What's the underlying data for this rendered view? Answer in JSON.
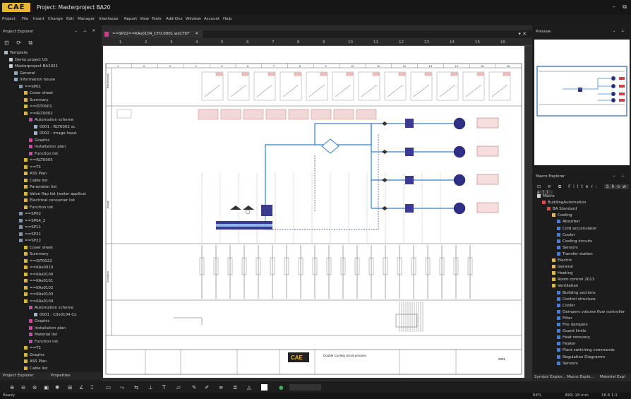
{
  "app": {
    "logo": "CAE",
    "title": "Project: Masterproject BA20"
  },
  "window_buttons": "– ⧉",
  "menu": [
    "Project",
    "File",
    "Insert",
    "Change",
    "Edit",
    "Manager",
    "Interfaces",
    "Report",
    "View",
    "Tools",
    "Add-Ons",
    "Window",
    "Account",
    "Help"
  ],
  "project_explorer": {
    "title": "Project Explorer",
    "tree": [
      {
        "label": "Template",
        "depth": 0
      },
      {
        "label": "Demo project US",
        "depth": 1
      },
      {
        "label": "Masterproject BA2021",
        "depth": 1
      },
      {
        "label": "General",
        "depth": 2
      },
      {
        "label": "Information house",
        "depth": 2
      },
      {
        "label": "==SP01",
        "depth": 3
      },
      {
        "label": "Cover sheet",
        "depth": 4
      },
      {
        "label": "Summary",
        "depth": 4
      },
      {
        "label": "==IST0001",
        "depth": 4
      },
      {
        "label": "==RLT0002",
        "depth": 4
      },
      {
        "label": "Automation scheme",
        "depth": 5
      },
      {
        "label": "0001 : RLT0002 sc",
        "depth": 6
      },
      {
        "label": "0002 : Image Input",
        "depth": 6
      },
      {
        "label": "Graphic",
        "depth": 5
      },
      {
        "label": "Installation plan",
        "depth": 5
      },
      {
        "label": "Function list",
        "depth": 5
      },
      {
        "label": "==RLT0005",
        "depth": 4
      },
      {
        "label": "==T1",
        "depth": 4
      },
      {
        "label": "ASS Plan",
        "depth": 4
      },
      {
        "label": "Cable list",
        "depth": 4
      },
      {
        "label": "Parameter list",
        "depth": 4
      },
      {
        "label": "Valve flap list (water applicat",
        "depth": 4
      },
      {
        "label": "Electrical consumer list",
        "depth": 4
      },
      {
        "label": "Function list",
        "depth": 4
      },
      {
        "label": "==SP02",
        "depth": 3
      },
      {
        "label": "==SP04_2",
        "depth": 3
      },
      {
        "label": "==SP11",
        "depth": 3
      },
      {
        "label": "==SP21",
        "depth": 3
      },
      {
        "label": "==SP22",
        "depth": 3
      },
      {
        "label": "Cover sheet",
        "depth": 4
      },
      {
        "label": "Summary",
        "depth": 4
      },
      {
        "label": "==IST0022",
        "depth": 4
      },
      {
        "label": "==KAs0010",
        "depth": 4
      },
      {
        "label": "==KAs0100",
        "depth": 4
      },
      {
        "label": "==KAs0101",
        "depth": 4
      },
      {
        "label": "==KAs0102",
        "depth": 4
      },
      {
        "label": "==KAs0103",
        "depth": 4
      },
      {
        "label": "==KAs0104",
        "depth": 4
      },
      {
        "label": "Automation scheme",
        "depth": 5
      },
      {
        "label": "0001 : C0s0104 Co",
        "depth": 6
      },
      {
        "label": "Graphic",
        "depth": 5
      },
      {
        "label": "Installation plan",
        "depth": 5
      },
      {
        "label": "Material list",
        "depth": 5
      },
      {
        "label": "Function list",
        "depth": 5
      },
      {
        "label": "==T1",
        "depth": 4
      },
      {
        "label": "Graphic",
        "depth": 4
      },
      {
        "label": "ASS Plan",
        "depth": 4
      },
      {
        "label": "Cable list",
        "depth": 4
      }
    ],
    "tabs": [
      "Project Explorer",
      "Properties"
    ]
  },
  "document": {
    "tab_label": "==SP22==KAs0104_CTD.0001.wsCTD*",
    "ruler": [
      "1",
      "2",
      "3",
      "4",
      "5",
      "6",
      "7",
      "8",
      "9",
      "10",
      "11",
      "12",
      "13",
      "14",
      "15",
      "16"
    ],
    "sheet_columns": [
      "1",
      "2",
      "3",
      "4",
      "5",
      "6",
      "7",
      "8",
      "9",
      "10",
      "11",
      "12",
      "13",
      "14",
      "15",
      "16"
    ],
    "row_labels": [
      "Betriebsmeld.",
      "Anlage",
      "Schaltschr."
    ],
    "title_block": {
      "company": "CAE",
      "description": "Double Cooling circuit process",
      "sheet": "0001"
    }
  },
  "preview": {
    "title": "Preview"
  },
  "macro_explorer": {
    "title": "Macro Explorer",
    "filter_label": "Filter:",
    "filter_value": "Show all",
    "tree": [
      {
        "label": "Macro",
        "depth": 0
      },
      {
        "label": "BuildingAutomation",
        "depth": 1
      },
      {
        "label": "BA Standard",
        "depth": 2
      },
      {
        "label": "Cooling",
        "depth": 3
      },
      {
        "label": "Absorber",
        "depth": 4
      },
      {
        "label": "Cold accumulator",
        "depth": 4
      },
      {
        "label": "Cooler",
        "depth": 4
      },
      {
        "label": "Cooling circuits",
        "depth": 4
      },
      {
        "label": "Sensors",
        "depth": 4
      },
      {
        "label": "Transfer station",
        "depth": 4
      },
      {
        "label": "Electric",
        "depth": 3
      },
      {
        "label": "General",
        "depth": 3
      },
      {
        "label": "Heating",
        "depth": 3
      },
      {
        "label": "Room control 2013",
        "depth": 3
      },
      {
        "label": "Ventilation",
        "depth": 3
      },
      {
        "label": "Building sections",
        "depth": 4
      },
      {
        "label": "Control structure",
        "depth": 4
      },
      {
        "label": "Cooler",
        "depth": 4
      },
      {
        "label": "Dampers volume flow controller",
        "depth": 4
      },
      {
        "label": "Filter",
        "depth": 4
      },
      {
        "label": "Fire dampers",
        "depth": 4
      },
      {
        "label": "Guard limits",
        "depth": 4
      },
      {
        "label": "Heat recovery",
        "depth": 4
      },
      {
        "label": "Heater",
        "depth": 4
      },
      {
        "label": "Plant switching commands",
        "depth": 4
      },
      {
        "label": "Regulation Diagramm",
        "depth": 4
      },
      {
        "label": "Sensors",
        "depth": 4
      }
    ],
    "tabs": [
      "Symbol Explor...",
      "Macro Explo...",
      "Material Expl"
    ]
  },
  "status": {
    "left": "Ready",
    "zoom": "64%",
    "coords": "490/-18 mm",
    "grid": "16.6 1:1"
  }
}
